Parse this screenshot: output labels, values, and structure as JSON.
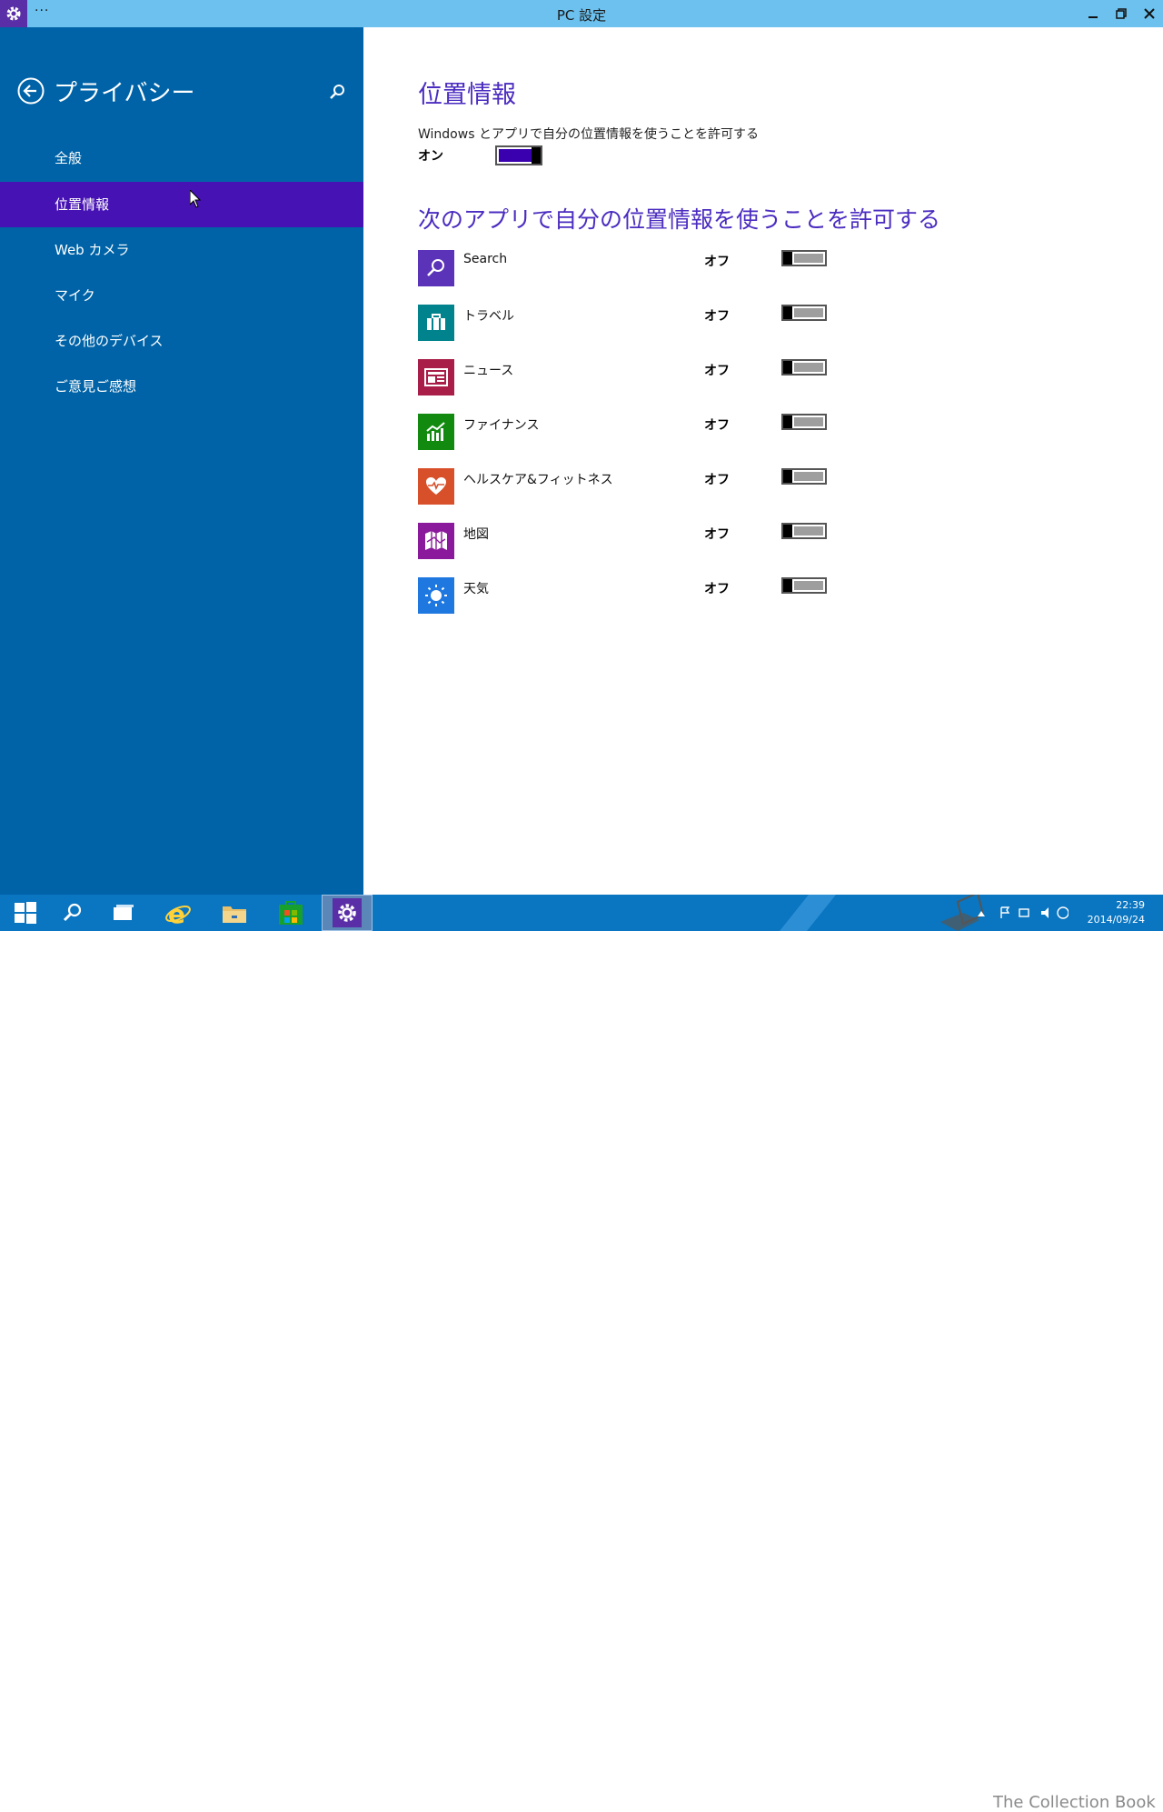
{
  "window": {
    "title": "PC 設定",
    "menu_dots": "···"
  },
  "sidebar": {
    "title": "プライバシー",
    "items": [
      {
        "label": "全般",
        "selected": false
      },
      {
        "label": "位置情報",
        "selected": true
      },
      {
        "label": "Web カメラ",
        "selected": false
      },
      {
        "label": "マイク",
        "selected": false
      },
      {
        "label": "その他のデバイス",
        "selected": false
      },
      {
        "label": "ご意見ご感想",
        "selected": false
      }
    ]
  },
  "main": {
    "location_heading": "位置情報",
    "location_description": "Windows とアプリで自分の位置情報を使うことを許可する",
    "location_state": "オン",
    "location_toggle_on": true,
    "apps_heading": "次のアプリで自分の位置情報を使うことを許可する",
    "apps": [
      {
        "name": "Search",
        "state": "オフ",
        "color": "#5b33b8",
        "icon": "search-icon"
      },
      {
        "name": "トラベル",
        "state": "オフ",
        "color": "#00838c",
        "icon": "suitcase-icon"
      },
      {
        "name": "ニュース",
        "state": "オフ",
        "color": "#a91e48",
        "icon": "newspaper-icon"
      },
      {
        "name": "ファイナンス",
        "state": "オフ",
        "color": "#128a0f",
        "icon": "chart-icon"
      },
      {
        "name": "ヘルスケア&フィットネス",
        "state": "オフ",
        "color": "#d8502a",
        "icon": "heart-icon"
      },
      {
        "name": "地図",
        "state": "オフ",
        "color": "#8a1a9b",
        "icon": "map-icon"
      },
      {
        "name": "天気",
        "state": "オフ",
        "color": "#1e78e0",
        "icon": "sun-icon"
      }
    ]
  },
  "taskbar": {
    "clock_time": "22:39",
    "clock_date": "2014/09/24",
    "watermark": "The Collection Book"
  },
  "colors": {
    "titlebar": "#6cc1ee",
    "sidebar": "#0063a7",
    "selected": "#4612b3",
    "heading": "#4b2cc0",
    "taskbar": "#0a75c0"
  }
}
